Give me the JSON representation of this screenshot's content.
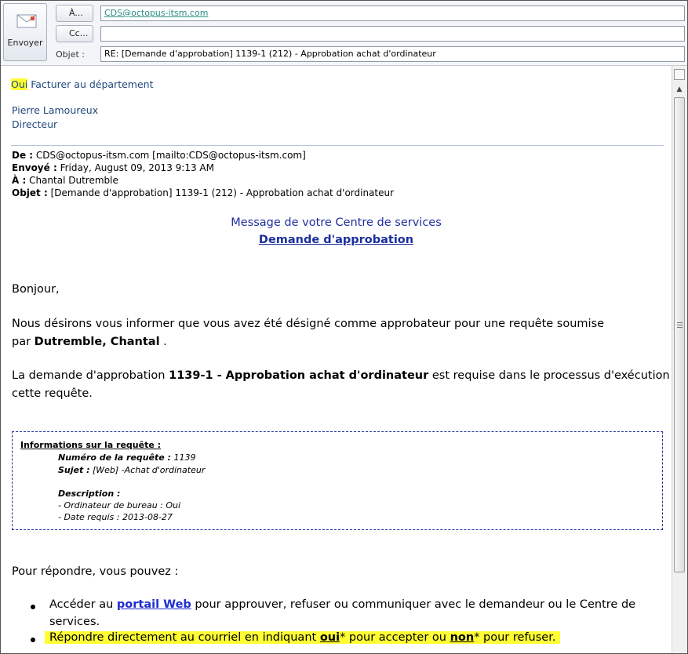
{
  "header": {
    "send_label": "Envoyer",
    "to_label": "À...",
    "cc_label": "Cc...",
    "subject_label": "Objet :",
    "to_value": "CDS@octopus-itsm.com",
    "cc_value": "",
    "subject_value": "RE: [Demande d'approbation] 1139-1 (212) - Approbation achat d'ordinateur"
  },
  "reply": {
    "answer": "Oui",
    "note": "Facturer au département",
    "signature_name": "Pierre Lamoureux",
    "signature_title": "Directeur"
  },
  "original": {
    "from_label": "De :",
    "from_value": "CDS@octopus-itsm.com [mailto:CDS@octopus-itsm.com]",
    "sent_label": "Envoyé :",
    "sent_value": "Friday, August 09, 2013 9:13 AM",
    "to_label": "À :",
    "to_value": "Chantal Dutremble",
    "subject_label": "Objet :",
    "subject_value": "[Demande d'approbation] 1139-1 (212) - Approbation achat d'ordinateur"
  },
  "message": {
    "title": "Message de votre Centre de services",
    "subtitle": "Demande d'approbation",
    "greeting": "Bonjour,",
    "p1_line1": "Nous désirons vous informer que vous avez été désigné comme approbateur pour une requête soumise",
    "p1_line2_pre": "par",
    "p1_line2_name": "Dutremble, Chantal",
    "p1_line2_post": ".",
    "p2_pre": "La demande d'approbation",
    "p2_bold": "1139-1 - Approbation achat d'ordinateur",
    "p2_post": "est requise dans le processus d'exécution de",
    "p2_line2": "cette requête."
  },
  "info_box": {
    "heading": "Informations sur la requête :",
    "number_label": "Numéro de la requête :",
    "number_value": "1139",
    "subject_label": "Sujet :",
    "subject_value": "[Web] -Achat d'ordinateur",
    "description_label": "Description :",
    "desc_line1": "- Ordinateur de bureau : Oui",
    "desc_line2": "- Date requis : 2013-08-27"
  },
  "response": {
    "intro": "Pour répondre, vous pouvez :",
    "b1_pre": "Accéder au",
    "b1_link": "portail Web",
    "b1_post": "pour approuver, refuser ou communiquer avec le demandeur ou le Centre de",
    "b1_line2": "services.",
    "b2_pre": "Répondre directement au courriel en indiquant",
    "b2_yes": "oui",
    "b2_mid": "* pour accepter ou",
    "b2_no": "non",
    "b2_post": "* pour refuser."
  },
  "colors": {
    "highlight": "#ffff33",
    "signature": "#1f497d",
    "title_blue": "#1f2f9f",
    "link_blue": "#1f2ecf"
  }
}
